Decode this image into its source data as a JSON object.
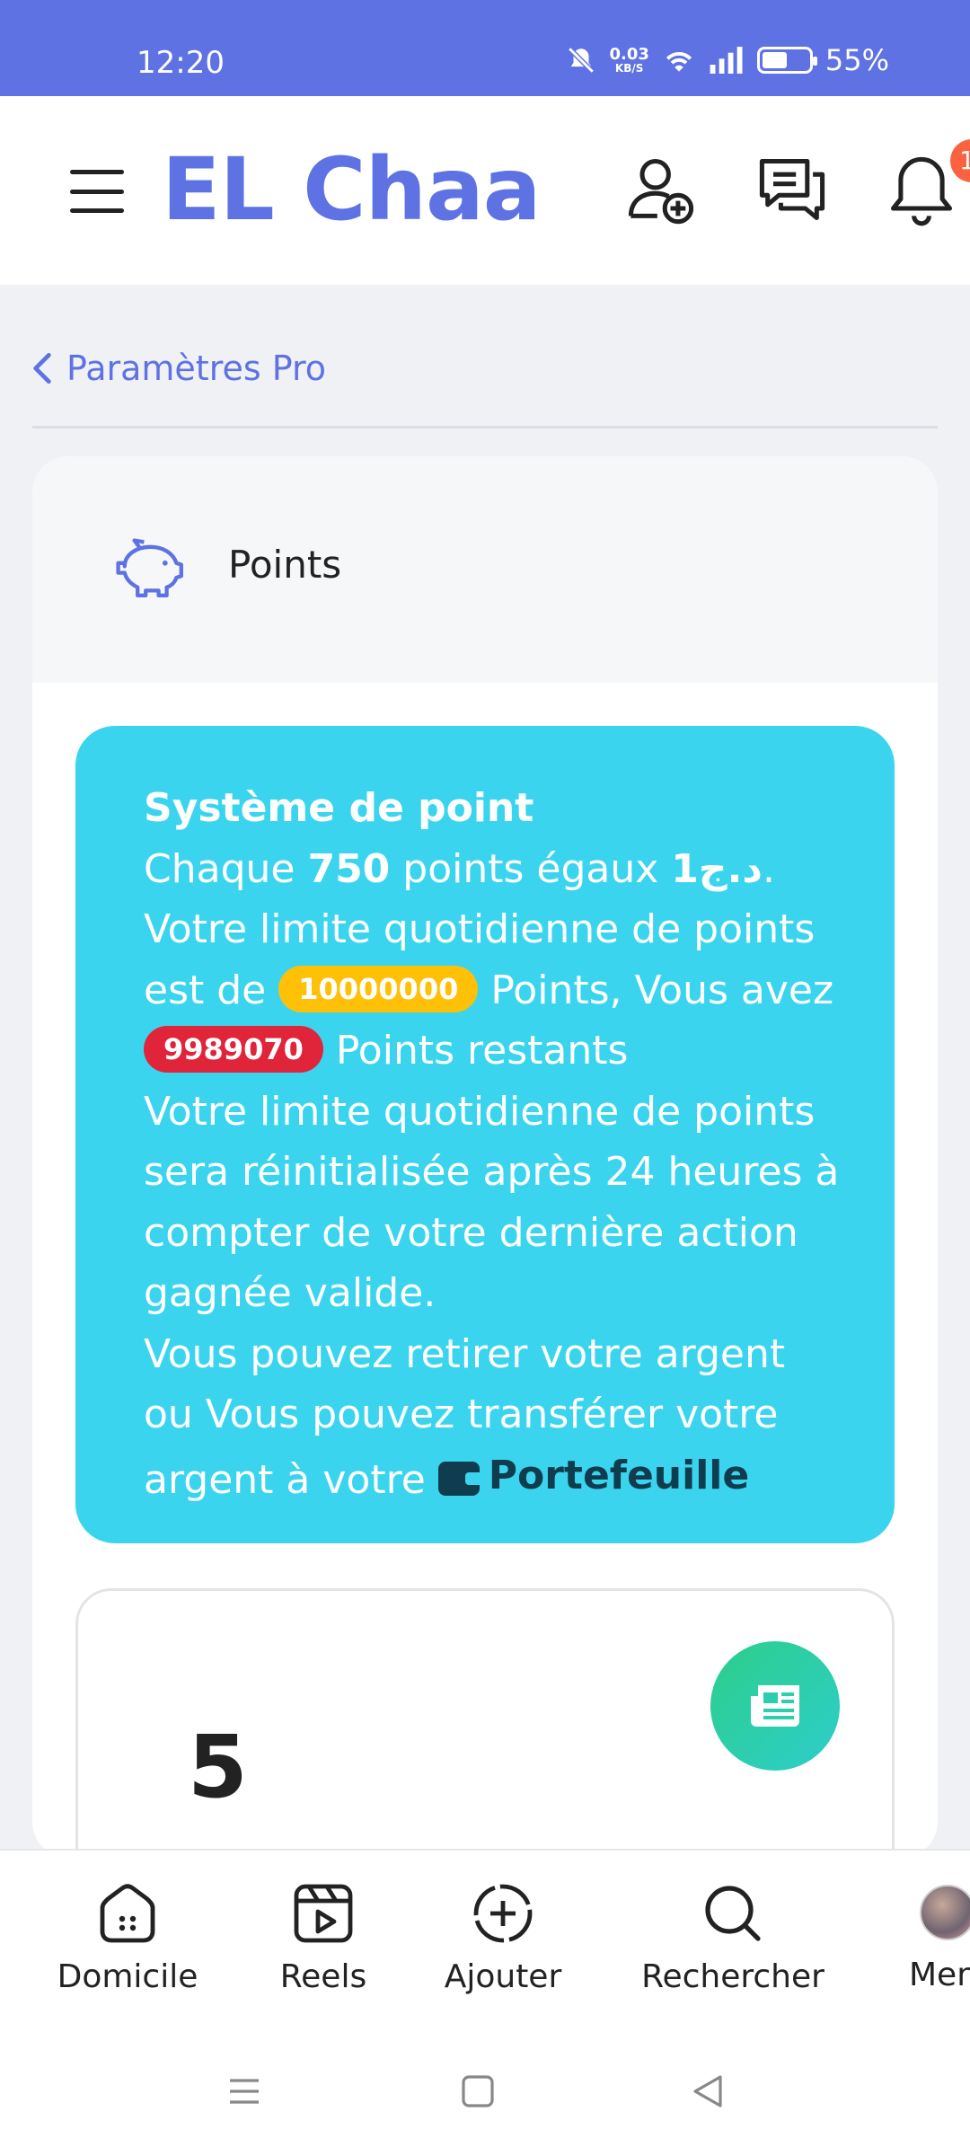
{
  "status_bar": {
    "time": "12:20",
    "net_speed": "0.03",
    "net_unit": "KB/S",
    "battery": "55%",
    "battery_level": 0.55
  },
  "header": {
    "brand": "EL Chaa",
    "notification_count": "1"
  },
  "breadcrumb": {
    "label": "Paramètres Pro"
  },
  "card": {
    "title": "Points",
    "info": {
      "title": "Système de point",
      "line1_a": "Chaque ",
      "points_per": "750",
      "line1_b": " points égaux ",
      "currency_amount": "1",
      "currency": "د.ج",
      "line1_end": ".",
      "line2_a": "Votre limite quotidienne de points est de ",
      "daily_limit": "10000000",
      "line2_b": " Points, Vous avez ",
      "remaining": "9989070",
      "line2_c": " Points restants",
      "line3": "Votre limite quotidienne de points sera réinitialisée après 24 heures à compter de votre dernière action gagnée valide.",
      "line4": "Vous pouvez retirer votre argent ou Vous pouvez transférer votre argent à votre ",
      "wallet_link": "Portefeuille"
    },
    "stat_value": "5"
  },
  "bottom_nav": {
    "items": [
      {
        "label": "Domicile",
        "icon": "home-icon"
      },
      {
        "label": "Reels",
        "icon": "reels-icon"
      },
      {
        "label": "Ajouter",
        "icon": "add-circle-icon"
      },
      {
        "label": "Rechercher",
        "icon": "search-icon"
      },
      {
        "label": "Men",
        "icon": "avatar"
      }
    ]
  },
  "colors": {
    "primary": "#5e72e4",
    "info_bg": "#3bd4ef",
    "pill_yellow": "#ffc107",
    "pill_red": "#e0243a",
    "green": "#2dce89"
  }
}
